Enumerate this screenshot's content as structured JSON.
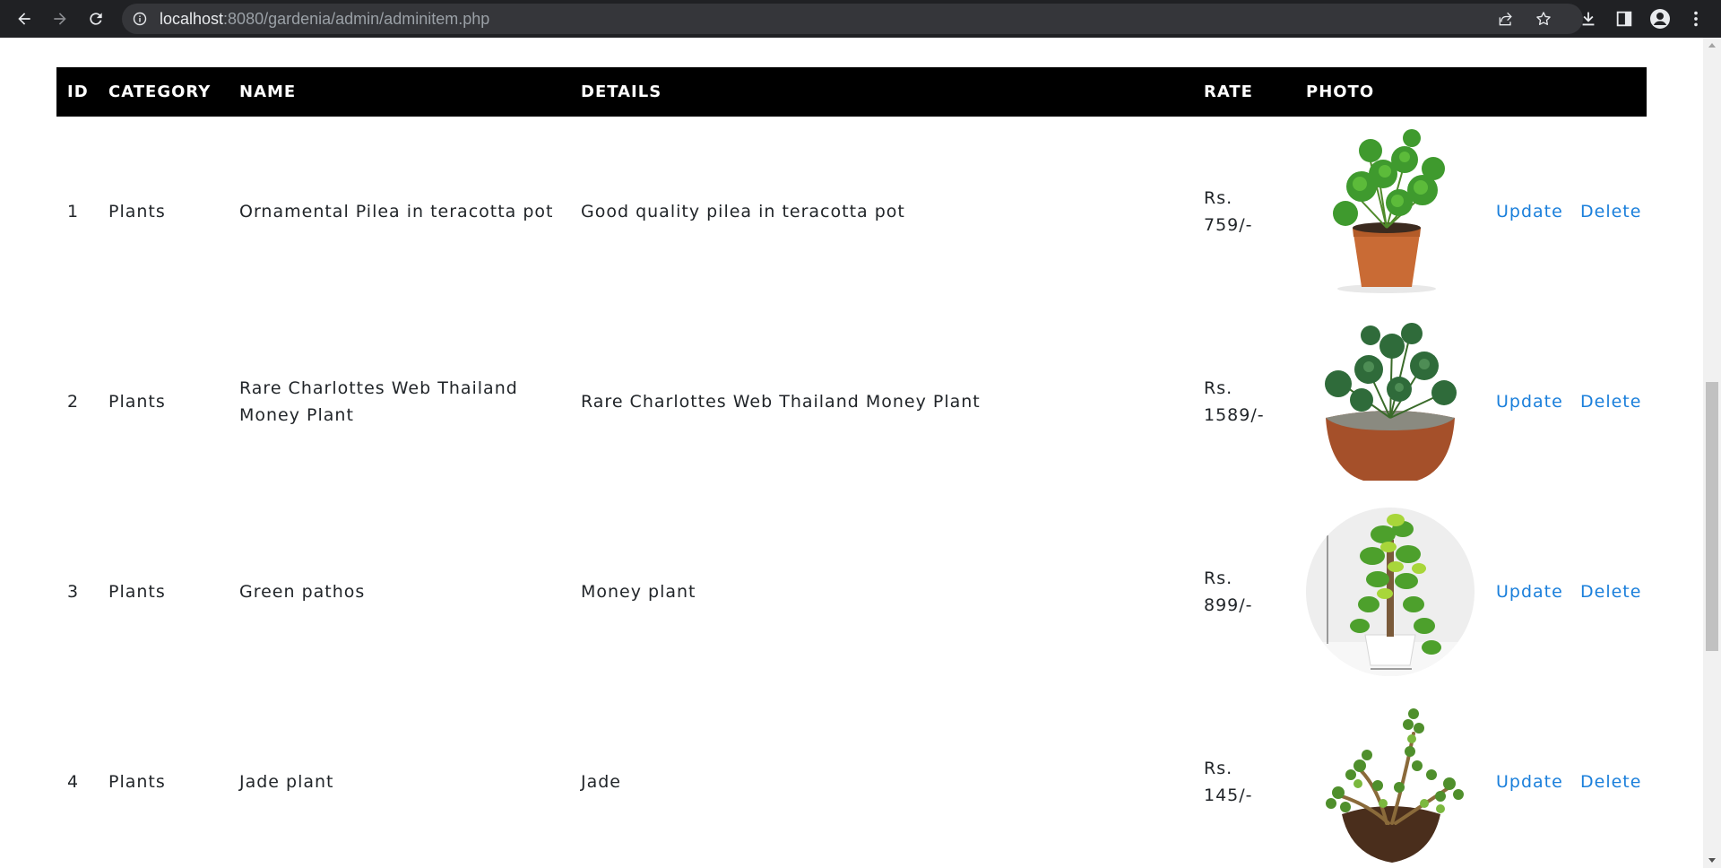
{
  "browser": {
    "url_host": "localhost",
    "url_rest": ":8080/gardenia/admin/adminitem.php"
  },
  "table": {
    "headers": [
      "ID",
      "CATEGORY",
      "NAME",
      "DETAILS",
      "RATE",
      "PHOTO"
    ],
    "rows": [
      {
        "id": "1",
        "category": "Plants",
        "name": "Ornamental Pilea in teracotta pot",
        "details": "Good quality pilea in teracotta pot",
        "rate": "Rs. 759/-",
        "update": "Update",
        "delete": "Delete"
      },
      {
        "id": "2",
        "category": "Plants",
        "name": "Rare Charlottes Web Thailand Money Plant",
        "details": "Rare Charlottes Web Thailand Money Plant",
        "rate": "Rs. 1589/-",
        "update": "Update",
        "delete": "Delete"
      },
      {
        "id": "3",
        "category": "Plants",
        "name": "Green pathos",
        "details": "Money plant",
        "rate": "Rs. 899/-",
        "update": "Update",
        "delete": "Delete"
      },
      {
        "id": "4",
        "category": "Plants",
        "name": "Jade plant",
        "details": "Jade",
        "rate": "Rs. 145/-",
        "update": "Update",
        "delete": "Delete"
      }
    ]
  },
  "colors": {
    "header_bg": "#000000",
    "link": "#1a7fdb",
    "chrome_bg": "#202124"
  }
}
